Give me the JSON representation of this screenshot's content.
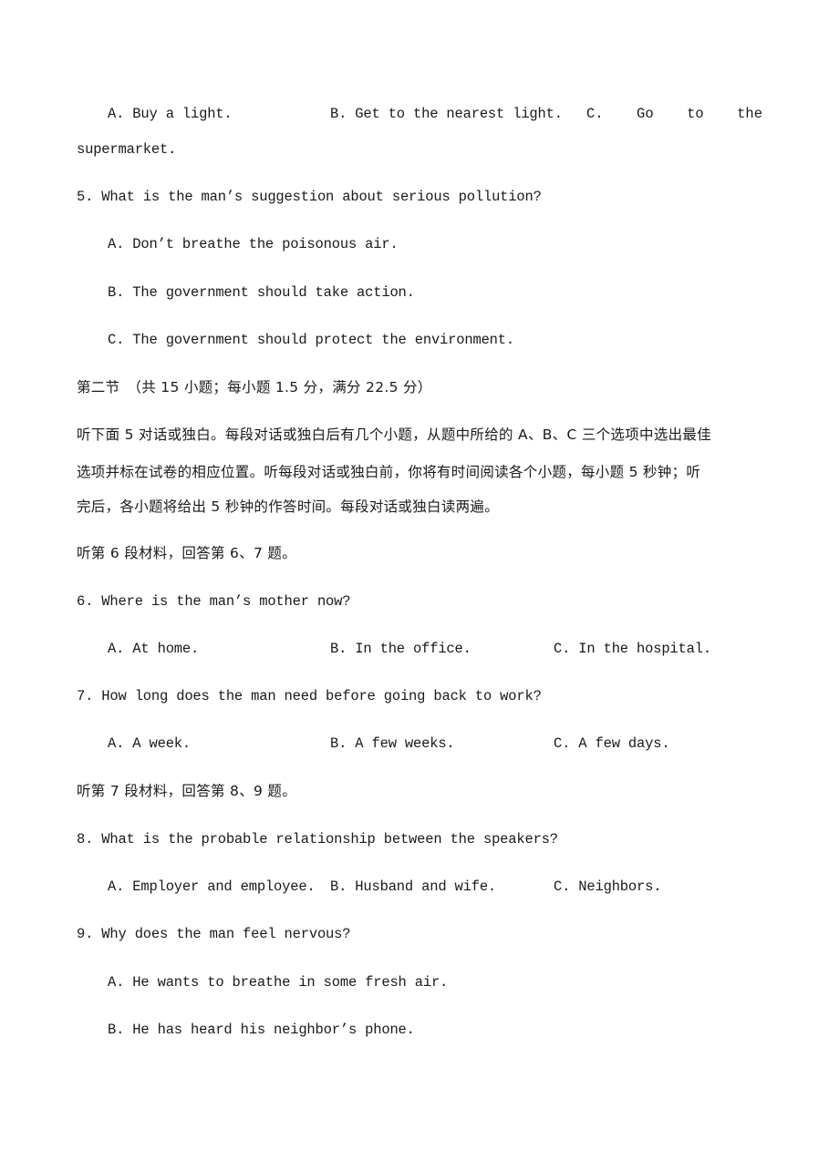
{
  "q4_options": {
    "A": "A. Buy a light.",
    "B": "B. Get to the nearest light.",
    "C_parts": [
      "C.",
      "Go",
      "to",
      "the"
    ],
    "C_continuation": "supermarket."
  },
  "q5": {
    "question": "5. What is the man’s suggestion about serious pollution?",
    "A": "A. Don’t breathe the poisonous air.",
    "B": "B. The government should take action.",
    "C": "C. The government should protect the environment."
  },
  "section2": {
    "heading": "第二节　（共 15 小题；每小题 1.5 分，满分 22.5 分）",
    "instructions": [
      "听下面 5 对话或独白。每段对话或独白后有几个小题，从题中所给的 A、B、C 三个选项中选出最佳",
      "选项并标在试卷的相应位置。听每段对话或独白前，你将有时间阅读各个小题，每小题 5 秒钟；听",
      "完后，各小题将给出 5 秒钟的作答时间。每段对话或独白读两遍。"
    ]
  },
  "material6": "听第 6 段材料，回答第 6、7 题。",
  "q6": {
    "question": "6. Where is the man’s mother now?",
    "A": "A. At home.",
    "B": "B. In the office.",
    "C": "C. In the hospital."
  },
  "q7": {
    "question": "7. How long does the man need before going back to work?",
    "A": "A. A week.",
    "B": "B. A few weeks.",
    "C": "C. A few days."
  },
  "material7": "听第 7 段材料，回答第 8、9 题。",
  "q8": {
    "question": "8. What is the probable relationship between the speakers?",
    "A": "A. Employer and employee.",
    "B": "B. Husband and wife.",
    "C": "C. Neighbors."
  },
  "q9": {
    "question": "9. Why does the man feel nervous?",
    "A": "A. He wants to breathe in some fresh air.",
    "B": "B. He has heard his neighbor’s phone."
  }
}
